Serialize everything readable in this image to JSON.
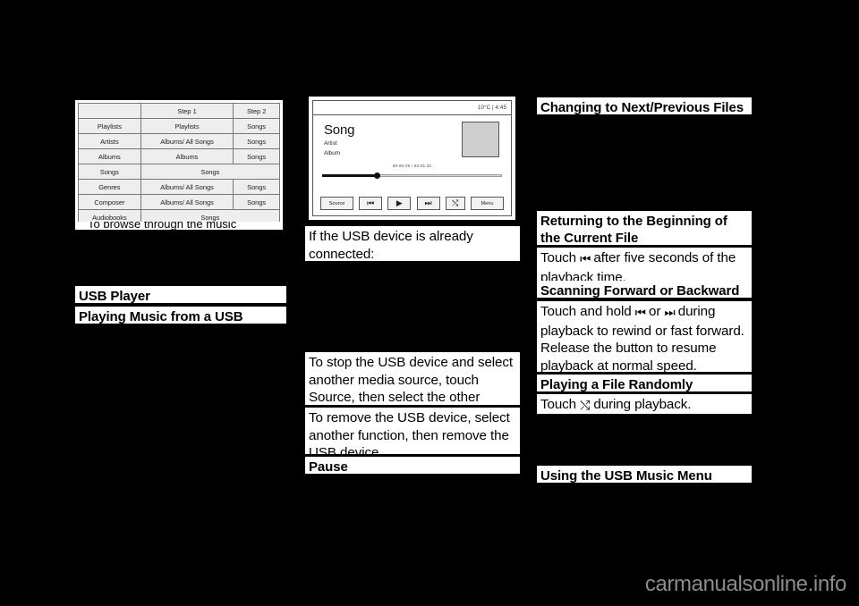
{
  "figure_table": {
    "columns": [
      "",
      "Step 1",
      "Step 2"
    ],
    "rows": [
      {
        "c0": "",
        "c1": "Step 1",
        "c2": "Step 2",
        "header": true
      },
      {
        "c0": "Playlists",
        "c1": "Playlists",
        "c2": "Songs"
      },
      {
        "c0": "Artists",
        "c1": "Albums/ All Songs",
        "c2": "Songs"
      },
      {
        "c0": "Albums",
        "c1": "Albums",
        "c2": "Songs"
      },
      {
        "c0": "Songs",
        "c1": "Songs",
        "c2": "",
        "span": true
      },
      {
        "c0": "Genres",
        "c1": "Albums/ All Songs",
        "c2": "Songs"
      },
      {
        "c0": "Composer",
        "c1": "Albums/ All Songs",
        "c2": "Songs"
      },
      {
        "c0": "Audiobooks",
        "c1": "Songs",
        "c2": "",
        "span": true
      }
    ],
    "caption_partial": "To browse through the music"
  },
  "figure_player": {
    "status": "10°C | 4:45",
    "song": "Song",
    "artist": "Artist",
    "album": "Album",
    "timecode": "00:00:29 / 02:01:32",
    "progress_percent": 32,
    "controls": [
      {
        "name": "source-button",
        "label": "Source"
      },
      {
        "name": "previous-button",
        "label": "⏮"
      },
      {
        "name": "play-button",
        "label": "▶"
      },
      {
        "name": "next-button",
        "label": "⏭"
      },
      {
        "name": "shuffle-button",
        "label": "⤭"
      },
      {
        "name": "menu-button",
        "label": "Menu"
      }
    ]
  },
  "left_column": {
    "heading_usb_player": "USB Player",
    "heading_playing_music": "Playing Music from a USB Device"
  },
  "middle_column": {
    "already_connected": "If the USB device is already connected:",
    "stop_device": "To stop the USB device and select another media source, touch Source, then select the other source.",
    "remove_device": "To remove the USB device, select another function, then remove the USB device.",
    "heading_pause": "Pause"
  },
  "right_column": {
    "heading_changing_files": "Changing to Next/Previous Files",
    "heading_returning": "Returning to the Beginning of the Current File",
    "returning_body_pre": "Touch ",
    "returning_body_post": " after five seconds of the playback time.",
    "returning_glyph": "⏮",
    "heading_scanning": "Scanning Forward or Backward",
    "scanning_pre": "Touch and hold ",
    "scanning_mid": " or ",
    "scanning_post": " during playback to rewind or fast forward. Release the button to resume playback at normal speed.",
    "scanning_glyph_back": "⏮",
    "scanning_glyph_fwd": "⏭",
    "heading_random": "Playing a File Randomly",
    "random_pre": "Touch ",
    "random_glyph": "⤭",
    "random_post": " during playback.",
    "heading_usb_menu": "Using the USB Music Menu"
  },
  "watermark": "carmanualsonline.info"
}
